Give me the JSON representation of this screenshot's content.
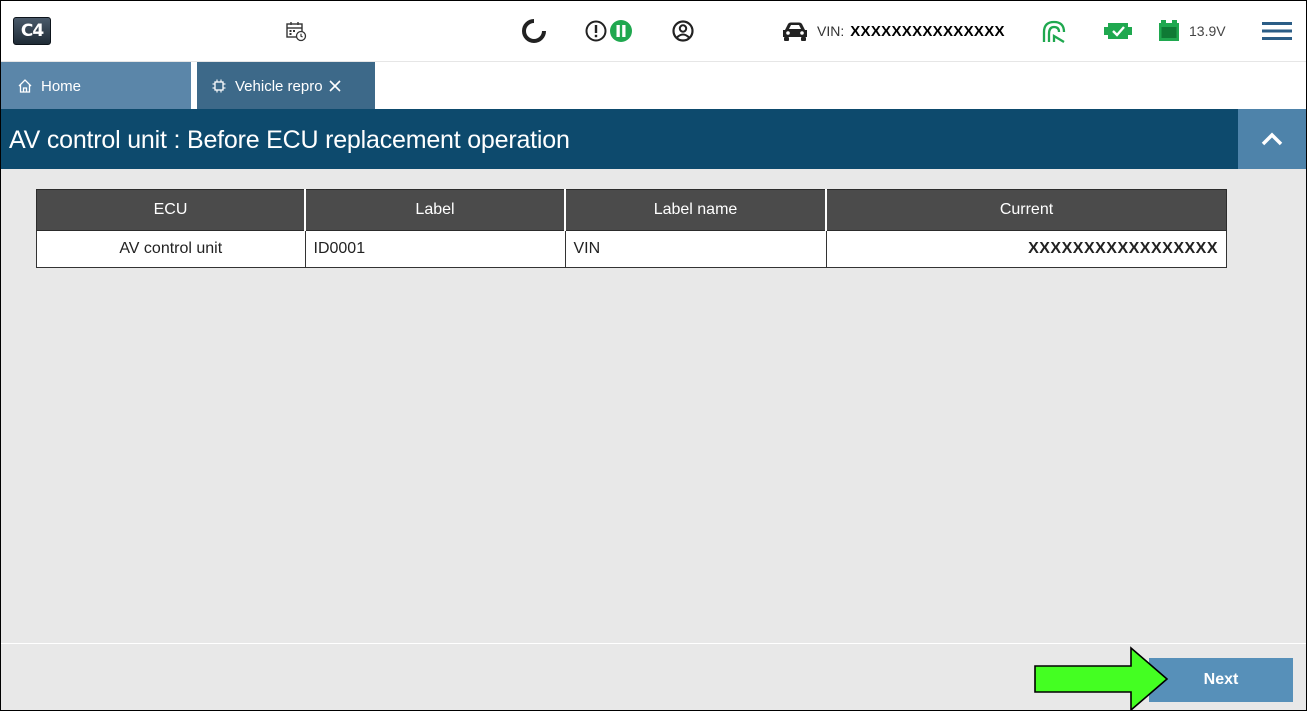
{
  "header": {
    "logo_text": "C4",
    "vin_label": "VIN:",
    "vin_value": "XXXXXXXXXXXXXXX",
    "voltage": "13.9V",
    "icons": [
      "calendar-clock-icon",
      "refresh-icon",
      "alert-icon",
      "pause-icon",
      "user-icon",
      "car-icon",
      "wireless-icon",
      "vi-status-icon",
      "battery-icon",
      "menu-icon"
    ],
    "accent_green": "#1fa84f"
  },
  "tabs": [
    {
      "label": "Home"
    },
    {
      "label": "Vehicle repro"
    }
  ],
  "title": "AV control unit : Before ECU replacement operation",
  "table": {
    "columns": [
      "ECU",
      "Label",
      "Label name",
      "Current"
    ],
    "rows": [
      {
        "ecu": "AV control unit",
        "label": "ID0001",
        "label_name": "VIN",
        "current": "XXXXXXXXXXXXXXXXX"
      }
    ]
  },
  "footer": {
    "next_label": "Next"
  },
  "colors": {
    "title_bar": "#0d4a6d",
    "tab_home": "#5b86a9",
    "tab_active": "#3d6989",
    "next_button": "#5790b9",
    "arrow_green": "#44ff22"
  }
}
